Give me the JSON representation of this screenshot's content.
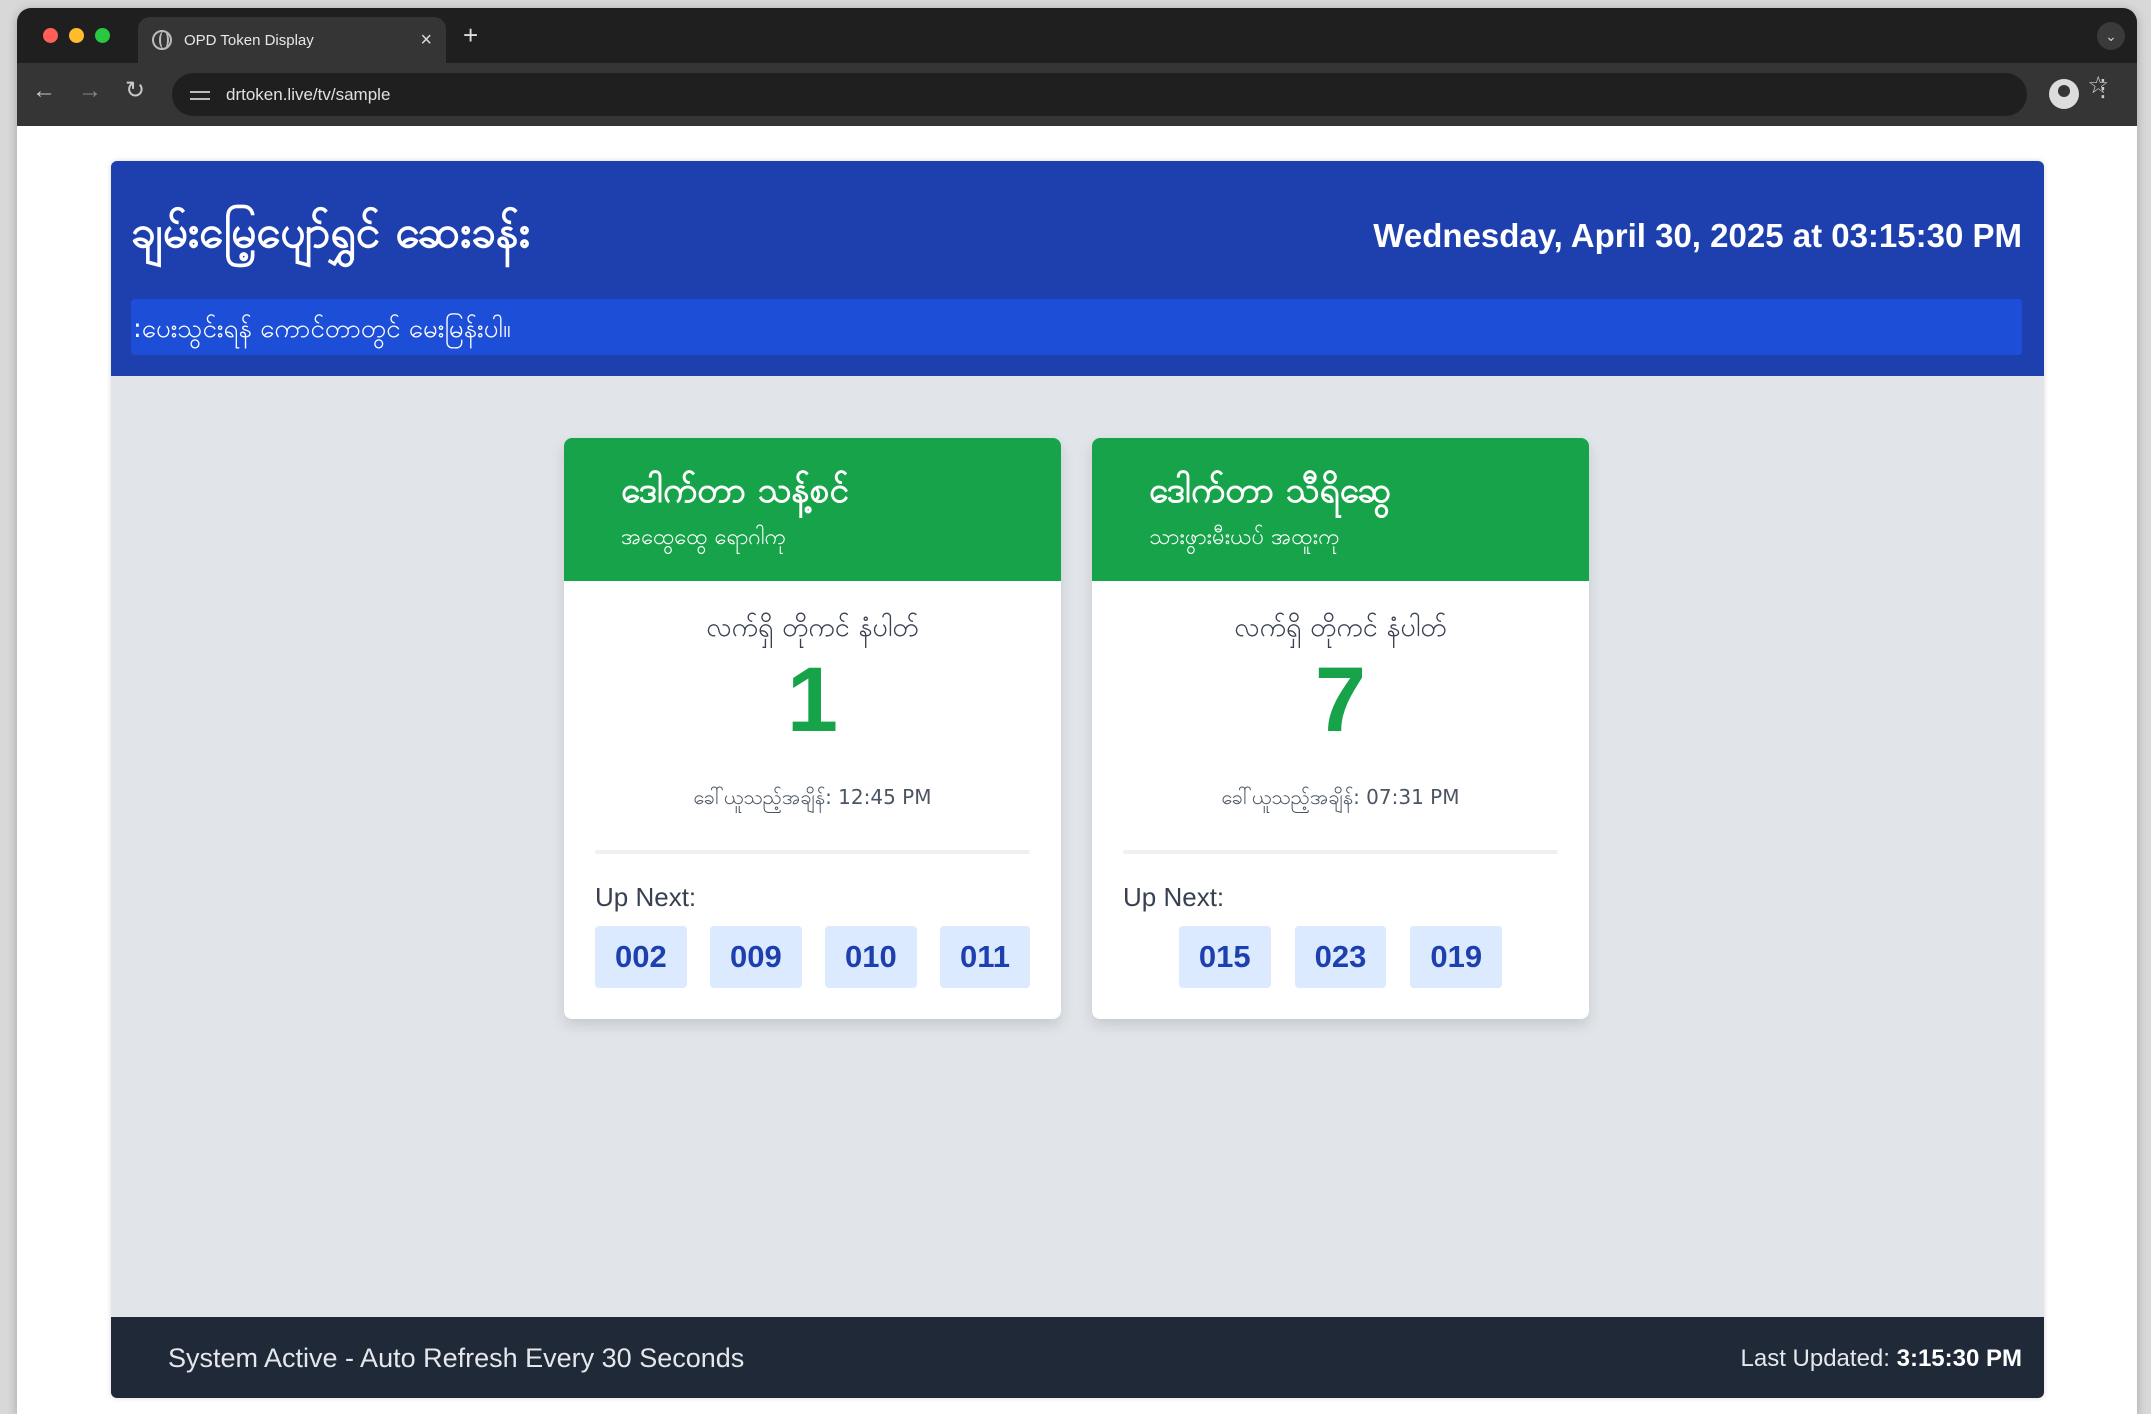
{
  "browser": {
    "tab_title": "OPD Token Display",
    "url": "drtoken.live/tv/sample"
  },
  "header": {
    "clinic_name": "ချမ်းမြေ့ပျော်ရွှင် ဆေးခန်း",
    "datetime": "Wednesday, April 30, 2025 at 03:15:30 PM",
    "notice": ":ပေးသွင်းရန် ကောင်တာတွင် မေးမြန်းပါ။"
  },
  "doctors": [
    {
      "name": "ဒေါက်တာ သန့်စင်",
      "specialty": "အထွေထွေ ရောဂါကု",
      "current_label": "လက်ရှိ တိုကင် နံပါတ်",
      "current_number": "1",
      "called_at": "ခေါ်ယူသည့်အချိန်: 12:45 PM",
      "up_next_label": "Up Next:",
      "up_next": [
        "002",
        "009",
        "010",
        "011"
      ]
    },
    {
      "name": "ဒေါက်တာ သီရိဆွေ",
      "specialty": "သားဖွားမီးယပ် အထူးကု",
      "current_label": "လက်ရှိ တိုကင် နံပါတ်",
      "current_number": "7",
      "called_at": "ခေါ်ယူသည့်အချိန်: 07:31 PM",
      "up_next_label": "Up Next:",
      "up_next": [
        "015",
        "023",
        "019"
      ]
    }
  ],
  "footer": {
    "status": "System Active - Auto Refresh Every 30 Seconds",
    "last_updated_label": "Last Updated:",
    "last_updated_time": "3:15:30 PM"
  },
  "colors": {
    "header_blue": "#1e40af",
    "notice_blue": "#1d4ed8",
    "doctor_green": "#16a34a",
    "chip_bg": "#dbeafe",
    "footer_dark": "#1f2937",
    "page_bg": "#e1e5ea"
  },
  "icons": [
    "globe-icon",
    "close-icon",
    "plus-icon",
    "chevron-down-icon",
    "back-arrow-icon",
    "forward-arrow-icon",
    "reload-icon",
    "site-settings-icon",
    "star-icon",
    "profile-icon",
    "kebab-menu-icon"
  ]
}
